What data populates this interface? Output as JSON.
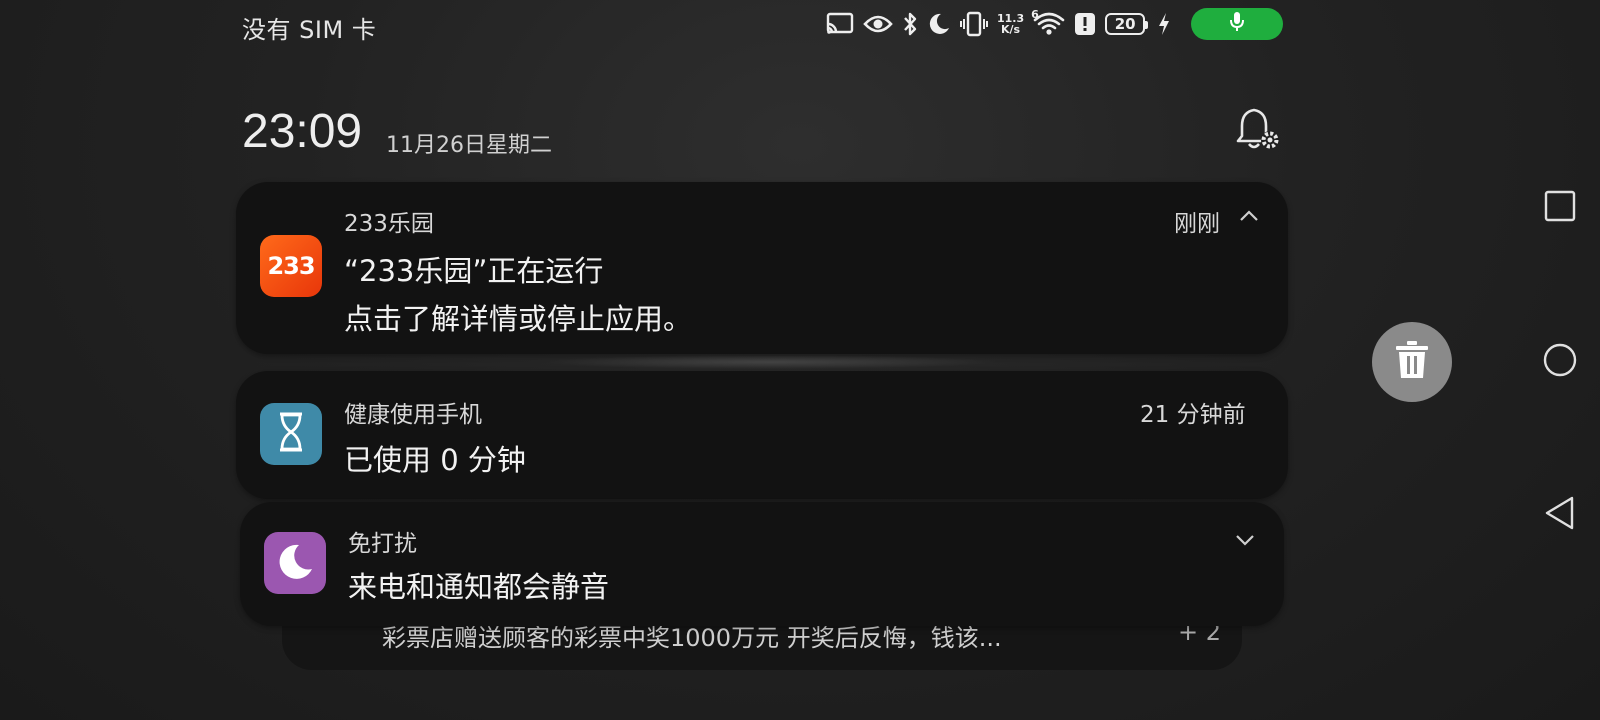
{
  "status_bar": {
    "carrier": "没有 SIM 卡",
    "network_speed_value": "11.3",
    "network_speed_unit": "K/s",
    "wifi_badge": "6",
    "battery_level": "20",
    "icons": [
      "cast-icon",
      "eye-comfort-icon",
      "bluetooth-icon",
      "do-not-disturb-icon",
      "vibrate-icon",
      "wifi-icon",
      "alert-icon",
      "battery-icon",
      "charging-icon",
      "microphone-icon"
    ],
    "mic_indicator_color": "#1fae3e"
  },
  "header": {
    "time": "23:09",
    "date": "11月26日星期二"
  },
  "notifications": [
    {
      "app": "233乐园",
      "icon_text": "233",
      "icon_color": "#f04a12",
      "title": "“233乐园”正在运行",
      "body": "点击了解详情或停止应用。",
      "time": "刚刚"
    },
    {
      "app": "健康使用手机",
      "icon": "hourglass-icon",
      "icon_color": "#3f8aa8",
      "title": "已使用 0 分钟",
      "time": "21 分钟前"
    },
    {
      "app": "免打扰",
      "icon": "moon-icon",
      "icon_color": "#9b57b0",
      "title": "来电和通知都会静音"
    }
  ],
  "stacked_notification": {
    "text": "彩票店赠送顾客的彩票中奖1000万元  开奖后反悔，钱该...",
    "more": "+ 2"
  },
  "nav": {
    "buttons": [
      "recents-square-icon",
      "home-circle-icon",
      "back-triangle-icon"
    ]
  }
}
